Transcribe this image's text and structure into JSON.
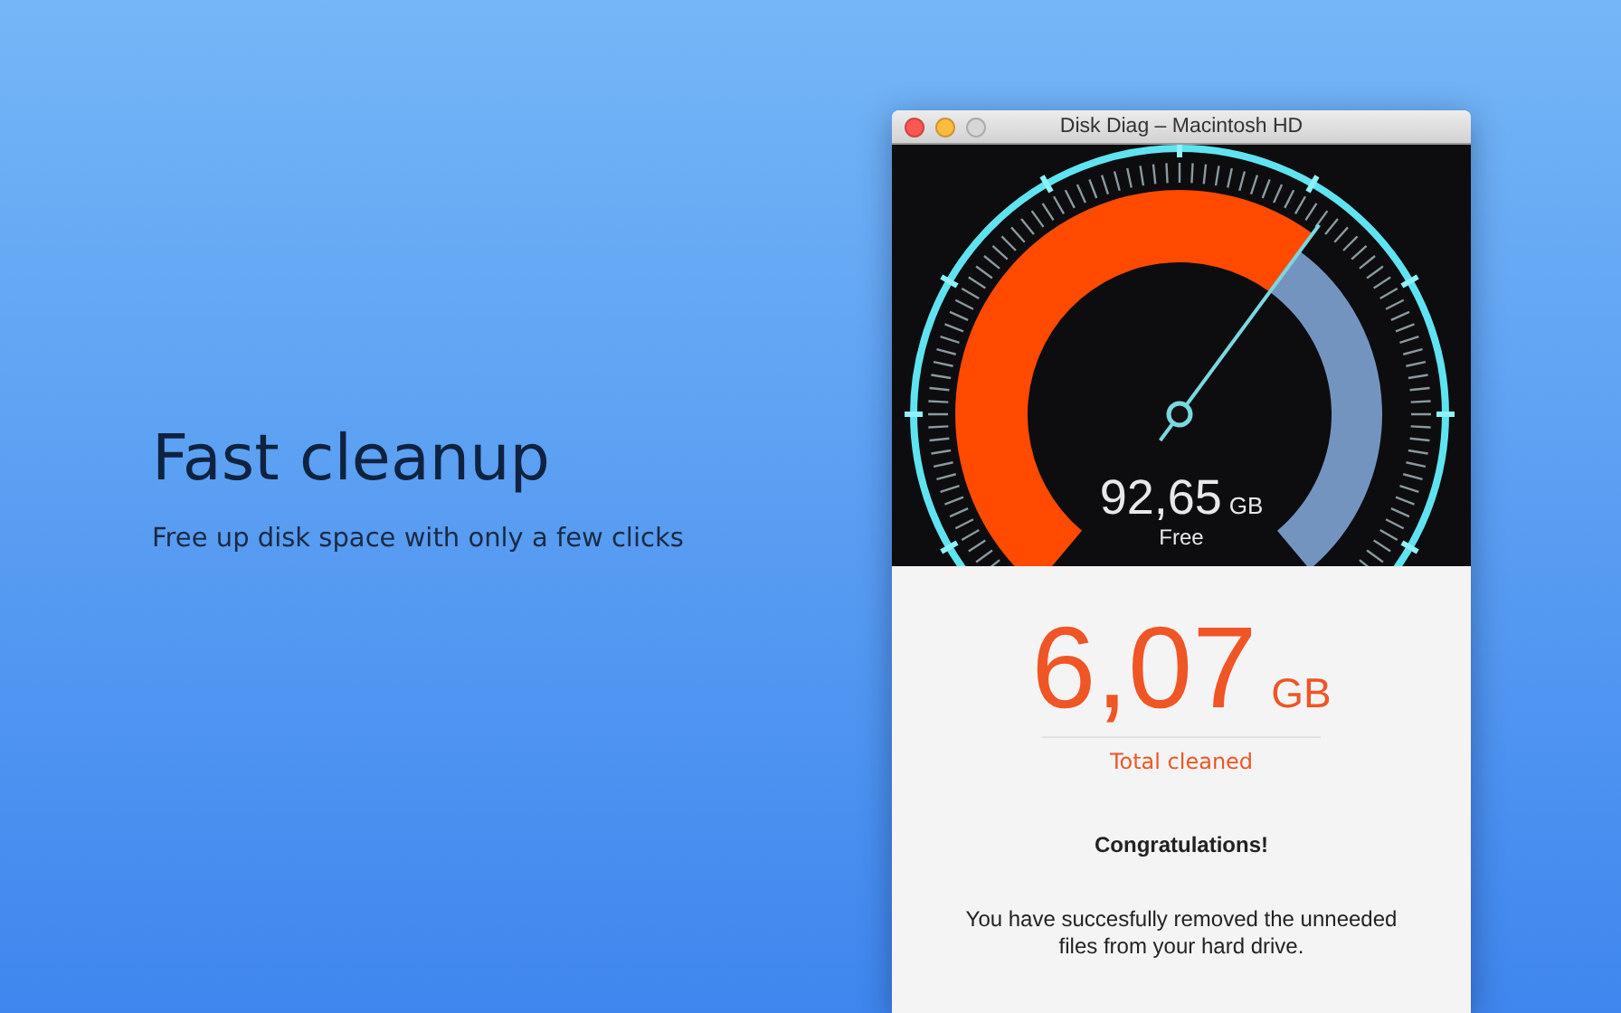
{
  "promo": {
    "title": "Fast cleanup",
    "subtitle": "Free up disk space with only a few clicks"
  },
  "window": {
    "title": "Disk Diag – Macintosh HD",
    "controls": [
      {
        "kind": "close",
        "disabled": false
      },
      {
        "kind": "minimize",
        "disabled": false
      },
      {
        "kind": "zoom",
        "disabled": true
      }
    ]
  },
  "gauge": {
    "value": "92,65",
    "unit": "GB",
    "label": "Free"
  },
  "result": {
    "value": "6,07",
    "unit": "GB",
    "label": "Total cleaned",
    "heading": "Congratulations!",
    "message": "You have succesfully removed the unneeded files from your hard drive."
  }
}
